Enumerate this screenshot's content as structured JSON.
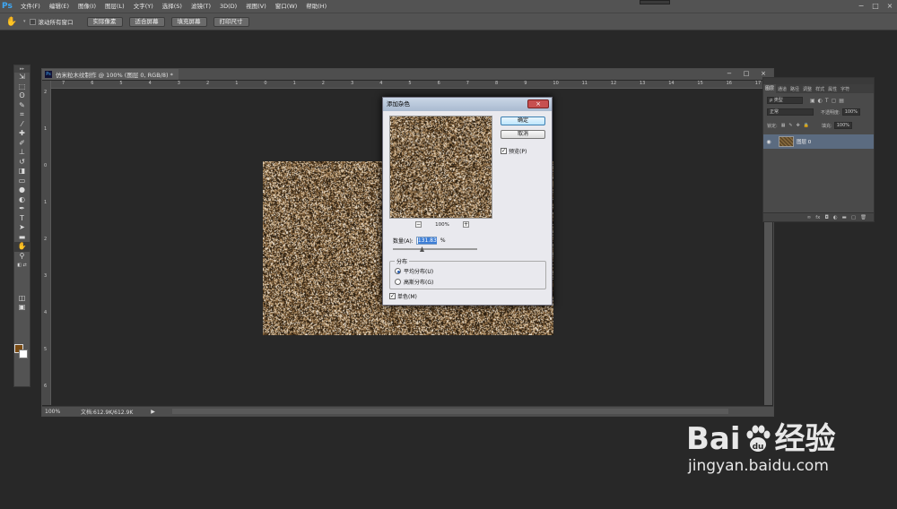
{
  "menu": {
    "logo": "Ps",
    "items": [
      "文件(F)",
      "编辑(E)",
      "图像(I)",
      "图层(L)",
      "文字(Y)",
      "选择(S)",
      "滤镜(T)",
      "3D(D)",
      "视图(V)",
      "窗口(W)",
      "帮助(H)"
    ]
  },
  "window_buttons": [
    "−",
    "□",
    "×"
  ],
  "options_bar": {
    "tool_icon": "hand-icon",
    "scroll_all_label": "滚动所有窗口",
    "buttons": [
      "实际像素",
      "适合屏幕",
      "填充屏幕",
      "打印尺寸"
    ]
  },
  "toolbox": {
    "tools": [
      "move-icon",
      "marquee-icon",
      "lasso-icon",
      "quick-select-icon",
      "crop-icon",
      "eyedropper-icon",
      "healing-icon",
      "brush-icon",
      "clone-stamp-icon",
      "history-brush-icon",
      "eraser-icon",
      "gradient-icon",
      "blur-icon",
      "dodge-icon",
      "pen-icon",
      "type-icon",
      "path-select-icon",
      "shape-icon",
      "hand-icon",
      "zoom-icon"
    ],
    "active_tool": "hand-icon",
    "foreground_color": "#7a4b13",
    "background_color": "#ffffff"
  },
  "document": {
    "title": "仿米粒木纹制作 @ 100% (图层 0, RGB/8) *",
    "buttons": [
      "−",
      "□",
      "×"
    ],
    "hruler_ticks": [
      "7",
      "6",
      "5",
      "4",
      "3",
      "2",
      "1",
      "0",
      "1",
      "2",
      "3",
      "4",
      "5",
      "6",
      "7",
      "8",
      "9",
      "10",
      "11",
      "12",
      "13",
      "14",
      "15",
      "16",
      "17"
    ],
    "vruler_ticks": [
      "2",
      "1",
      "0",
      "1",
      "2",
      "3",
      "4",
      "5",
      "6"
    ],
    "status_zoom": "100%",
    "status_info": "文档:612.9K/612.9K",
    "status_arrow": "▶"
  },
  "dialog": {
    "title": "添加杂色",
    "close": "×",
    "ok_label": "确定",
    "cancel_label": "取消",
    "preview_label": "预览(P)",
    "preview_checked": true,
    "zoom_minus": "−",
    "zoom_value": "100%",
    "zoom_plus": "+",
    "amount_label": "数量(A):",
    "amount_value": "131.83",
    "amount_unit": "%",
    "amount_slider_percent": 33,
    "distribution_label": "分布",
    "uniform_label": "平均分布(U)",
    "gaussian_label": "高斯分布(G)",
    "uniform_selected": true,
    "mono_label": "单色(M)",
    "mono_checked": true
  },
  "layers_panel": {
    "tabs": [
      "图层",
      "通道",
      "路径",
      "调整",
      "样式",
      "属性",
      "字符"
    ],
    "filter_kind": "ρ 类型",
    "blend_mode": "正常",
    "opacity_label": "不透明度:",
    "opacity_value": "100%",
    "lock_label": "锁定:",
    "fill_label": "填充:",
    "fill_value": "100%",
    "layer_name": "图层 0",
    "bottom_icons": [
      "∞",
      "fx",
      "◘",
      "◐",
      "▬",
      "▢",
      "🗑"
    ]
  },
  "watermark": {
    "brand": "Bai",
    "brand_suffix": "经验",
    "url": "jingyan.baidu.com"
  }
}
